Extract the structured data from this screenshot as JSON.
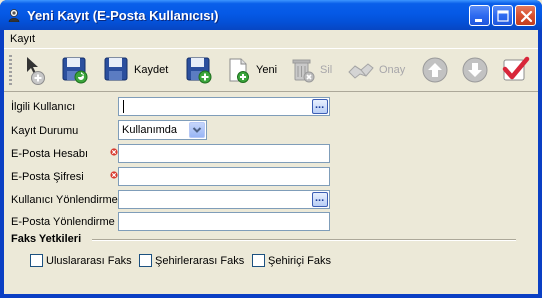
{
  "window": {
    "title": "Yeni Kayıt (E-Posta Kullanıcısı)",
    "controls": [
      "minimize",
      "maximize",
      "close"
    ]
  },
  "menu": [
    "Kayıt"
  ],
  "toolbar": {
    "buttons": [
      {
        "icon": "new-record-icon",
        "label": ""
      },
      {
        "icon": "save-icon",
        "label": ""
      },
      {
        "icon": "save-icon",
        "label": "Kaydet"
      },
      {
        "icon": "save-new-icon",
        "label": ""
      },
      {
        "icon": "new-document-icon",
        "label": "Yeni"
      },
      {
        "icon": "delete-icon",
        "label": "Sil",
        "disabled": true
      },
      {
        "icon": "approve-icon",
        "label": "Onay",
        "disabled": true
      },
      {
        "icon": "up-arrow-icon",
        "label": ""
      },
      {
        "icon": "down-arrow-icon",
        "label": ""
      },
      {
        "icon": "check-icon",
        "label": ""
      }
    ]
  },
  "form": {
    "related_user": {
      "label": "İlgili Kullanıcı",
      "value": ""
    },
    "record_status": {
      "label": "Kayıt Durumu",
      "value": "Kullanımda"
    },
    "email_account": {
      "label": "E-Posta Hesabı",
      "value": "",
      "required": true
    },
    "email_password": {
      "label": "E-Posta Şifresi",
      "value": "",
      "required": true
    },
    "user_redirect": {
      "label": "Kullanıcı Yönlendirme",
      "value": ""
    },
    "email_redirect": {
      "label": "E-Posta Yönlendirme",
      "value": ""
    }
  },
  "fax_permissions": {
    "title": "Faks Yetkileri",
    "options": [
      {
        "label": "Uluslararası Faks",
        "checked": false
      },
      {
        "label": "Şehirlerarası Faks",
        "checked": false
      },
      {
        "label": "Şehiriçi Faks",
        "checked": false
      }
    ]
  },
  "colors": {
    "title_bar": "#0559E6",
    "window_bg": "#ECE9D8",
    "required_marker": "#D83A2F"
  }
}
